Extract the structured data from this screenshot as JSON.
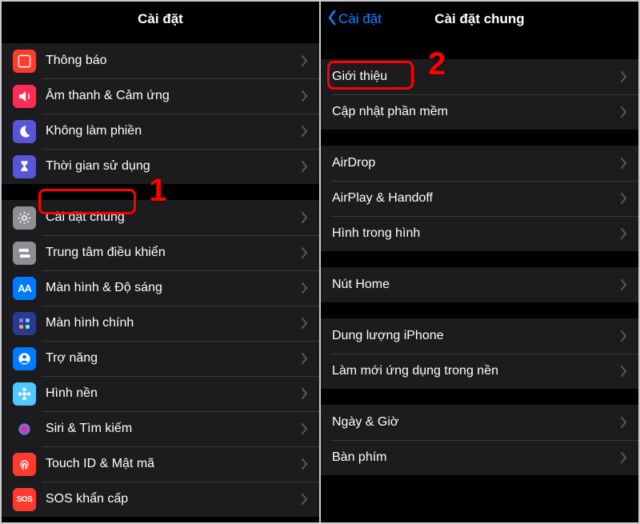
{
  "left": {
    "title": "Cài đặt",
    "group1": [
      {
        "name": "notifications",
        "label": "Thông báo",
        "color": "#ff3b30",
        "icon": "notification"
      },
      {
        "name": "sounds",
        "label": "Âm thanh & Cảm ứng",
        "color": "#ff2d55",
        "icon": "sound"
      },
      {
        "name": "dnd",
        "label": "Không làm phiền",
        "color": "#5856d6",
        "icon": "moon"
      },
      {
        "name": "screentime",
        "label": "Thời gian sử dụng",
        "color": "#5856d6",
        "icon": "hourglass"
      }
    ],
    "group2": [
      {
        "name": "general",
        "label": "Cài đặt chung",
        "color": "#8e8e93",
        "icon": "gear"
      },
      {
        "name": "controlcenter",
        "label": "Trung tâm điều khiển",
        "color": "#8e8e93",
        "icon": "switches"
      },
      {
        "name": "display",
        "label": "Màn hình & Độ sáng",
        "color": "#007aff",
        "icon": "aa"
      },
      {
        "name": "homescreen",
        "label": "Màn hình chính",
        "color": "#2b3a8f",
        "icon": "grid"
      },
      {
        "name": "accessibility",
        "label": "Trợ năng",
        "color": "#007aff",
        "icon": "person"
      },
      {
        "name": "wallpaper",
        "label": "Hình nền",
        "color": "#54c7fc",
        "icon": "flower"
      },
      {
        "name": "siri",
        "label": "Siri & Tìm kiếm",
        "color": "#1c1c1e",
        "icon": "siri"
      },
      {
        "name": "touchid",
        "label": "Touch ID & Mật mã",
        "color": "#ff3b30",
        "icon": "fingerprint"
      },
      {
        "name": "sos",
        "label": "SOS khẩn cấp",
        "color": "#ff3b30",
        "icon": "sos"
      }
    ]
  },
  "right": {
    "back": "Cài đặt",
    "title": "Cài đặt chung",
    "groups": [
      [
        {
          "name": "about",
          "label": "Giới thiệu"
        },
        {
          "name": "software",
          "label": "Cập nhật phần mềm"
        }
      ],
      [
        {
          "name": "airdrop",
          "label": "AirDrop"
        },
        {
          "name": "airplay",
          "label": "AirPlay & Handoff"
        },
        {
          "name": "pip",
          "label": "Hình trong hình"
        }
      ],
      [
        {
          "name": "home",
          "label": "Nút Home"
        }
      ],
      [
        {
          "name": "storage",
          "label": "Dung lượng iPhone"
        },
        {
          "name": "bgapp",
          "label": "Làm mới ứng dụng trong nền"
        }
      ],
      [
        {
          "name": "datetime",
          "label": "Ngày & Giờ"
        },
        {
          "name": "keyboard",
          "label": "Bàn phím"
        }
      ]
    ]
  },
  "annotations": {
    "one": "1",
    "two": "2"
  }
}
